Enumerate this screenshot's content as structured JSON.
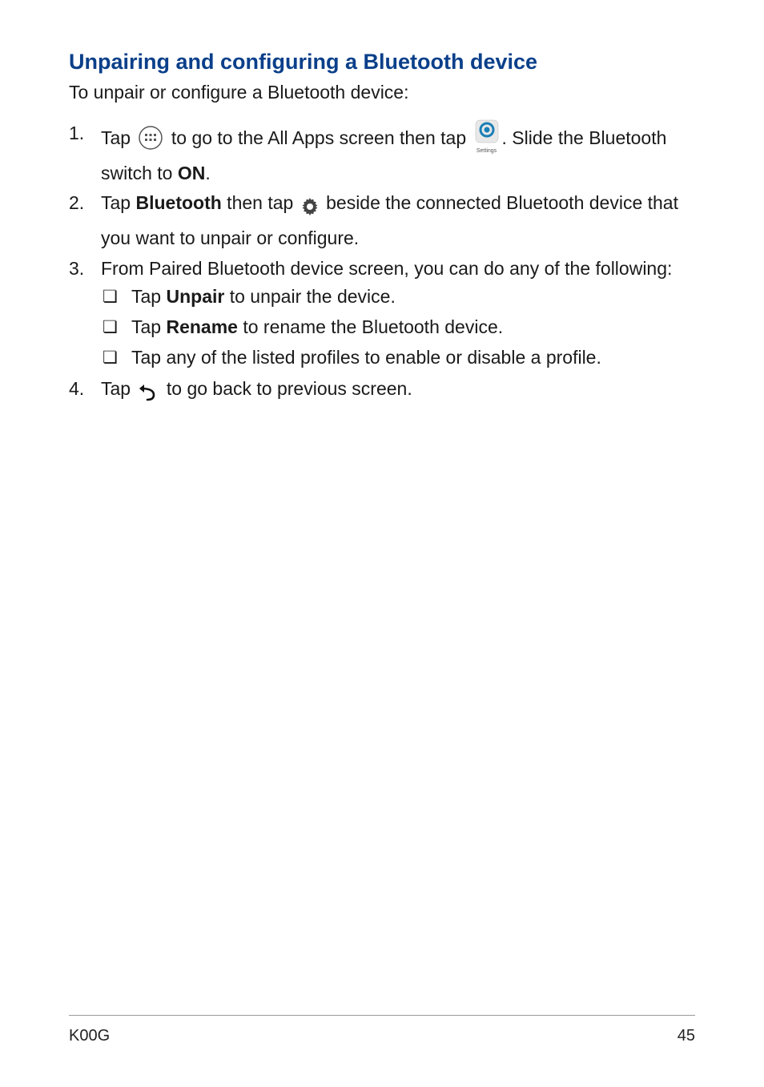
{
  "heading": "Unpairing and configuring a Bluetooth device",
  "intro": "To unpair or configure a Bluetooth device:",
  "steps": {
    "s1": {
      "num": "1.",
      "t1": "Tap ",
      "t2": " to go to the All Apps screen then tap ",
      "settings_caption": "Settings",
      "t3": ". Slide the Bluetooth switch to ",
      "on": "ON",
      "t4": "."
    },
    "s2": {
      "num": "2.",
      "t1": "Tap ",
      "bt": "Bluetooth",
      "t2": " then tap ",
      "t3": " beside the connected Bluetooth device that you want to unpair or configure."
    },
    "s3": {
      "num": "3.",
      "t1": "From Paired Bluetooth device screen, you can do any of the following:",
      "b1": {
        "mark": "❏",
        "pre": "Tap ",
        "bold": "Unpair",
        "post": " to unpair the device."
      },
      "b2": {
        "mark": "❏",
        "pre": "Tap ",
        "bold": "Rename",
        "post": " to rename the Bluetooth device."
      },
      "b3": {
        "mark": "❏",
        "text": "Tap any of the listed profiles to enable or disable a profile."
      }
    },
    "s4": {
      "num": "4.",
      "t1": "Tap ",
      "t2": " to go back to previous screen."
    }
  },
  "footer": {
    "model": "K00G",
    "page": "45"
  }
}
